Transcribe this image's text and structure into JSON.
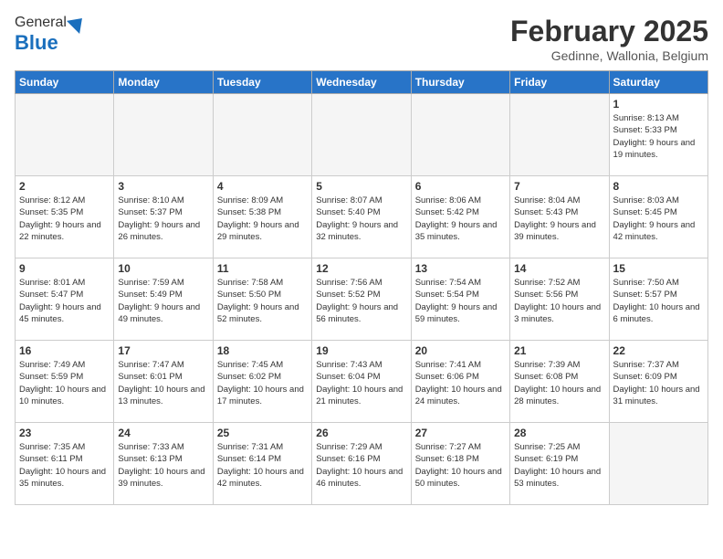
{
  "header": {
    "logo_general": "General",
    "logo_blue": "Blue",
    "month_year": "February 2025",
    "location": "Gedinne, Wallonia, Belgium"
  },
  "weekdays": [
    "Sunday",
    "Monday",
    "Tuesday",
    "Wednesday",
    "Thursday",
    "Friday",
    "Saturday"
  ],
  "weeks": [
    [
      {
        "day": "",
        "info": ""
      },
      {
        "day": "",
        "info": ""
      },
      {
        "day": "",
        "info": ""
      },
      {
        "day": "",
        "info": ""
      },
      {
        "day": "",
        "info": ""
      },
      {
        "day": "",
        "info": ""
      },
      {
        "day": "1",
        "info": "Sunrise: 8:13 AM\nSunset: 5:33 PM\nDaylight: 9 hours and 19 minutes."
      }
    ],
    [
      {
        "day": "2",
        "info": "Sunrise: 8:12 AM\nSunset: 5:35 PM\nDaylight: 9 hours and 22 minutes."
      },
      {
        "day": "3",
        "info": "Sunrise: 8:10 AM\nSunset: 5:37 PM\nDaylight: 9 hours and 26 minutes."
      },
      {
        "day": "4",
        "info": "Sunrise: 8:09 AM\nSunset: 5:38 PM\nDaylight: 9 hours and 29 minutes."
      },
      {
        "day": "5",
        "info": "Sunrise: 8:07 AM\nSunset: 5:40 PM\nDaylight: 9 hours and 32 minutes."
      },
      {
        "day": "6",
        "info": "Sunrise: 8:06 AM\nSunset: 5:42 PM\nDaylight: 9 hours and 35 minutes."
      },
      {
        "day": "7",
        "info": "Sunrise: 8:04 AM\nSunset: 5:43 PM\nDaylight: 9 hours and 39 minutes."
      },
      {
        "day": "8",
        "info": "Sunrise: 8:03 AM\nSunset: 5:45 PM\nDaylight: 9 hours and 42 minutes."
      }
    ],
    [
      {
        "day": "9",
        "info": "Sunrise: 8:01 AM\nSunset: 5:47 PM\nDaylight: 9 hours and 45 minutes."
      },
      {
        "day": "10",
        "info": "Sunrise: 7:59 AM\nSunset: 5:49 PM\nDaylight: 9 hours and 49 minutes."
      },
      {
        "day": "11",
        "info": "Sunrise: 7:58 AM\nSunset: 5:50 PM\nDaylight: 9 hours and 52 minutes."
      },
      {
        "day": "12",
        "info": "Sunrise: 7:56 AM\nSunset: 5:52 PM\nDaylight: 9 hours and 56 minutes."
      },
      {
        "day": "13",
        "info": "Sunrise: 7:54 AM\nSunset: 5:54 PM\nDaylight: 9 hours and 59 minutes."
      },
      {
        "day": "14",
        "info": "Sunrise: 7:52 AM\nSunset: 5:56 PM\nDaylight: 10 hours and 3 minutes."
      },
      {
        "day": "15",
        "info": "Sunrise: 7:50 AM\nSunset: 5:57 PM\nDaylight: 10 hours and 6 minutes."
      }
    ],
    [
      {
        "day": "16",
        "info": "Sunrise: 7:49 AM\nSunset: 5:59 PM\nDaylight: 10 hours and 10 minutes."
      },
      {
        "day": "17",
        "info": "Sunrise: 7:47 AM\nSunset: 6:01 PM\nDaylight: 10 hours and 13 minutes."
      },
      {
        "day": "18",
        "info": "Sunrise: 7:45 AM\nSunset: 6:02 PM\nDaylight: 10 hours and 17 minutes."
      },
      {
        "day": "19",
        "info": "Sunrise: 7:43 AM\nSunset: 6:04 PM\nDaylight: 10 hours and 21 minutes."
      },
      {
        "day": "20",
        "info": "Sunrise: 7:41 AM\nSunset: 6:06 PM\nDaylight: 10 hours and 24 minutes."
      },
      {
        "day": "21",
        "info": "Sunrise: 7:39 AM\nSunset: 6:08 PM\nDaylight: 10 hours and 28 minutes."
      },
      {
        "day": "22",
        "info": "Sunrise: 7:37 AM\nSunset: 6:09 PM\nDaylight: 10 hours and 31 minutes."
      }
    ],
    [
      {
        "day": "23",
        "info": "Sunrise: 7:35 AM\nSunset: 6:11 PM\nDaylight: 10 hours and 35 minutes."
      },
      {
        "day": "24",
        "info": "Sunrise: 7:33 AM\nSunset: 6:13 PM\nDaylight: 10 hours and 39 minutes."
      },
      {
        "day": "25",
        "info": "Sunrise: 7:31 AM\nSunset: 6:14 PM\nDaylight: 10 hours and 42 minutes."
      },
      {
        "day": "26",
        "info": "Sunrise: 7:29 AM\nSunset: 6:16 PM\nDaylight: 10 hours and 46 minutes."
      },
      {
        "day": "27",
        "info": "Sunrise: 7:27 AM\nSunset: 6:18 PM\nDaylight: 10 hours and 50 minutes."
      },
      {
        "day": "28",
        "info": "Sunrise: 7:25 AM\nSunset: 6:19 PM\nDaylight: 10 hours and 53 minutes."
      },
      {
        "day": "",
        "info": ""
      }
    ]
  ]
}
